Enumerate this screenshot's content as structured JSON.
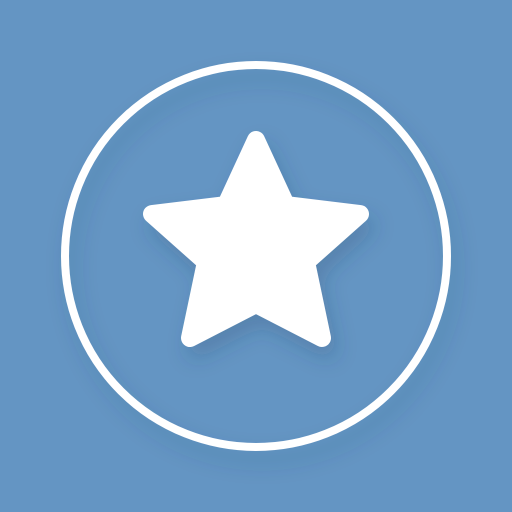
{
  "icon": {
    "name": "star-icon",
    "background_color": "#6495c3",
    "foreground_color": "#ffffff",
    "ring_color": "#ffffff"
  }
}
